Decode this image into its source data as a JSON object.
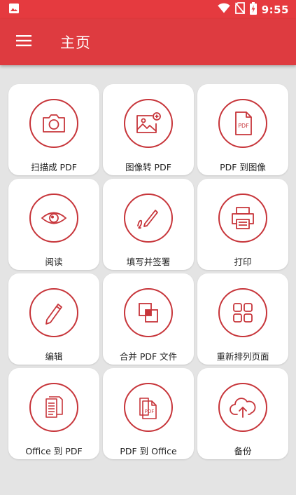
{
  "status_bar": {
    "time": "9:55",
    "icons": [
      "image-icon",
      "wifi-icon",
      "no-sim-icon",
      "battery-charging-icon"
    ]
  },
  "app_bar": {
    "title": "主页",
    "menu_icon": "hamburger-menu-icon"
  },
  "colors": {
    "primary": "#de3b40",
    "status_bar": "#e53a3f",
    "icon_stroke": "#c7353a",
    "background": "#e4e4e4"
  },
  "tools": [
    {
      "label": "扫描成 PDF",
      "icon": "camera-icon"
    },
    {
      "label": "图像转 PDF",
      "icon": "image-add-icon"
    },
    {
      "label": "PDF 到图像",
      "icon": "pdf-file-icon"
    },
    {
      "label": "阅读",
      "icon": "eye-icon"
    },
    {
      "label": "填写并签署",
      "icon": "pen-signature-icon"
    },
    {
      "label": "打印",
      "icon": "printer-icon"
    },
    {
      "label": "编辑",
      "icon": "pencil-icon"
    },
    {
      "label": "合并 PDF 文件",
      "icon": "merge-icon"
    },
    {
      "label": "重新排列页面",
      "icon": "grid-icon"
    },
    {
      "label": "Office 到 PDF",
      "icon": "document-icon"
    },
    {
      "label": "PDF 到 Office",
      "icon": "pdf-documents-icon"
    },
    {
      "label": "备份",
      "icon": "cloud-upload-icon"
    }
  ]
}
